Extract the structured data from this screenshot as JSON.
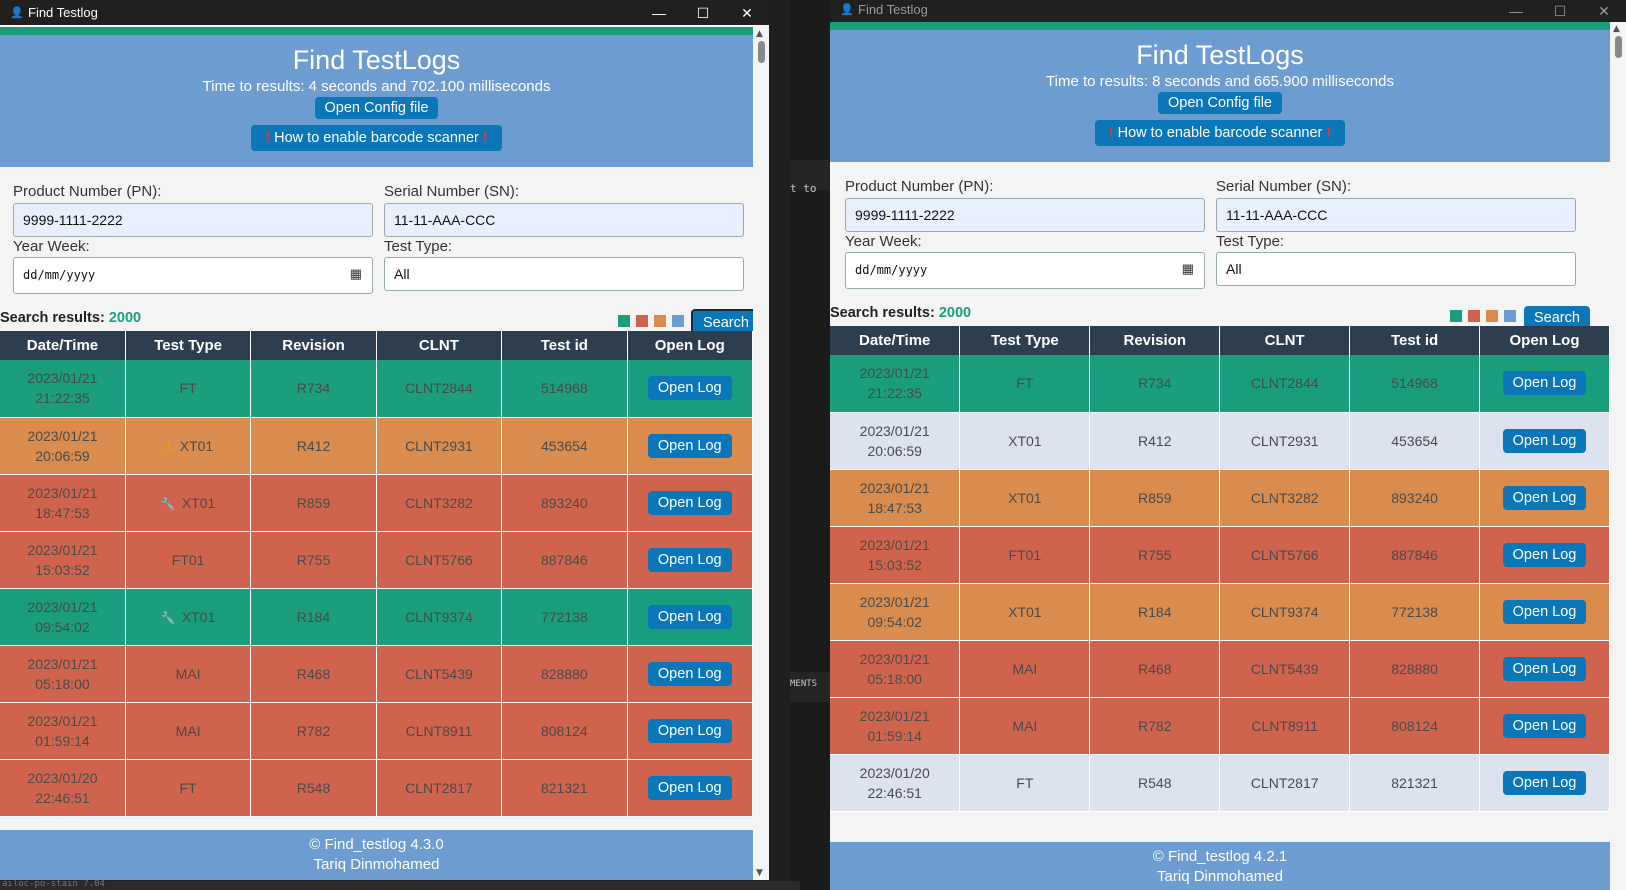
{
  "colors": {
    "accent": "#1b9e7e",
    "header": "#6c9cd0",
    "button": "#0b76b8",
    "table_header": "#2c3e50",
    "pass_green": "#1b9e7e",
    "orange": "#d98c4e",
    "fail_red": "#d0634d",
    "neutral": "#dde2ef"
  },
  "background": {
    "snippet_top": "t to",
    "snippet_mid": "MENTS",
    "snippet_bottom": "ailoc-po-stain 7.04"
  },
  "left": {
    "title": "Find Testlog",
    "heading": "Find TestLogs",
    "time": "Time to results: 4 seconds and 702.100 milliseconds",
    "open_config": "Open Config file",
    "scanner": "How to enable barcode scanner",
    "pn_label": "Product Number (PN):",
    "pn_value": "9999-1111-2222",
    "sn_label": "Serial Number (SN):",
    "sn_value": "11-11-AAA-CCC",
    "yw_label": "Year Week:",
    "yw_placeholder": "dd/mm/yyyy",
    "tt_label": "Test Type:",
    "tt_value": "All",
    "results_label": "Search results:",
    "results_count": "2000",
    "search": "Search",
    "columns": [
      "Date/Time",
      "Test Type",
      "Revision",
      "CLNT",
      "Test id",
      "Open Log"
    ],
    "rows": [
      {
        "date": "2023/01/21",
        "time": "21:22:35",
        "type": "FT",
        "icon": "",
        "rev": "R734",
        "clnt": "CLNT2844",
        "id": "514968",
        "color": "green"
      },
      {
        "date": "2023/01/21",
        "time": "20:06:59",
        "type": "XT01",
        "icon": "warning-icon",
        "rev": "R412",
        "clnt": "CLNT2931",
        "id": "453654",
        "color": "orange"
      },
      {
        "date": "2023/01/21",
        "time": "18:47:53",
        "type": "XT01",
        "icon": "wrench-icon",
        "rev": "R859",
        "clnt": "CLNT3282",
        "id": "893240",
        "color": "red"
      },
      {
        "date": "2023/01/21",
        "time": "15:03:52",
        "type": "FT01",
        "icon": "",
        "rev": "R755",
        "clnt": "CLNT5766",
        "id": "887846",
        "color": "red"
      },
      {
        "date": "2023/01/21",
        "time": "09:54:02",
        "type": "XT01",
        "icon": "wrench-icon",
        "rev": "R184",
        "clnt": "CLNT9374",
        "id": "772138",
        "color": "green"
      },
      {
        "date": "2023/01/21",
        "time": "05:18:00",
        "type": "MAI",
        "icon": "",
        "rev": "R468",
        "clnt": "CLNT5439",
        "id": "828880",
        "color": "red"
      },
      {
        "date": "2023/01/21",
        "time": "01:59:14",
        "type": "MAI",
        "icon": "",
        "rev": "R782",
        "clnt": "CLNT8911",
        "id": "808124",
        "color": "red"
      },
      {
        "date": "2023/01/20",
        "time": "22:46:51",
        "type": "FT",
        "icon": "",
        "rev": "R548",
        "clnt": "CLNT2817",
        "id": "821321",
        "color": "red"
      }
    ],
    "open_log": "Open Log",
    "footer_1": "© Find_testlog 4.3.0",
    "footer_2": "Tariq Dinmohamed"
  },
  "right": {
    "title": "Find Testlog",
    "heading": "Find TestLogs",
    "time": "Time to results: 8 seconds and 665.900 milliseconds",
    "open_config": "Open Config file",
    "scanner": "How to enable barcode scanner",
    "pn_label": "Product Number (PN):",
    "pn_value": "9999-1111-2222",
    "sn_label": "Serial Number (SN):",
    "sn_value": "11-11-AAA-CCC",
    "yw_label": "Year Week:",
    "yw_placeholder": "dd/mm/yyyy",
    "tt_label": "Test Type:",
    "tt_value": "All",
    "results_label": "Search results:",
    "results_count": "2000",
    "search": "Search",
    "columns": [
      "Date/Time",
      "Test Type",
      "Revision",
      "CLNT",
      "Test id",
      "Open Log"
    ],
    "rows": [
      {
        "date": "2023/01/21",
        "time": "21:22:35",
        "type": "FT",
        "icon": "",
        "rev": "R734",
        "clnt": "CLNT2844",
        "id": "514968",
        "color": "green"
      },
      {
        "date": "2023/01/21",
        "time": "20:06:59",
        "type": "XT01",
        "icon": "",
        "rev": "R412",
        "clnt": "CLNT2931",
        "id": "453654",
        "color": "lav"
      },
      {
        "date": "2023/01/21",
        "time": "18:47:53",
        "type": "XT01",
        "icon": "",
        "rev": "R859",
        "clnt": "CLNT3282",
        "id": "893240",
        "color": "orange"
      },
      {
        "date": "2023/01/21",
        "time": "15:03:52",
        "type": "FT01",
        "icon": "",
        "rev": "R755",
        "clnt": "CLNT5766",
        "id": "887846",
        "color": "red"
      },
      {
        "date": "2023/01/21",
        "time": "09:54:02",
        "type": "XT01",
        "icon": "",
        "rev": "R184",
        "clnt": "CLNT9374",
        "id": "772138",
        "color": "orange"
      },
      {
        "date": "2023/01/21",
        "time": "05:18:00",
        "type": "MAI",
        "icon": "",
        "rev": "R468",
        "clnt": "CLNT5439",
        "id": "828880",
        "color": "red"
      },
      {
        "date": "2023/01/21",
        "time": "01:59:14",
        "type": "MAI",
        "icon": "",
        "rev": "R782",
        "clnt": "CLNT8911",
        "id": "808124",
        "color": "red"
      },
      {
        "date": "2023/01/20",
        "time": "22:46:51",
        "type": "FT",
        "icon": "",
        "rev": "R548",
        "clnt": "CLNT2817",
        "id": "821321",
        "color": "lav"
      }
    ],
    "open_log": "Open Log",
    "footer_1": "© Find_testlog 4.2.1",
    "footer_2": "Tariq Dinmohamed"
  }
}
